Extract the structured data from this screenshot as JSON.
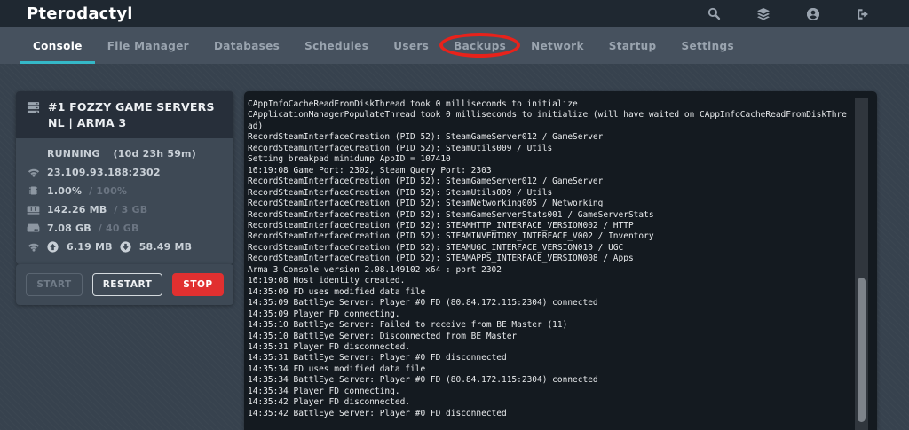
{
  "app": {
    "title": "Pterodactyl"
  },
  "topbar": {
    "icons": [
      "search-icon",
      "layers-icon",
      "user-circle-icon",
      "logout-icon"
    ]
  },
  "nav": {
    "tabs": [
      {
        "label": "Console",
        "active": true
      },
      {
        "label": "File Manager"
      },
      {
        "label": "Databases"
      },
      {
        "label": "Schedules"
      },
      {
        "label": "Users"
      },
      {
        "label": "Backups",
        "highlighted": true
      },
      {
        "label": "Network"
      },
      {
        "label": "Startup"
      },
      {
        "label": "Settings"
      }
    ],
    "highlight_annotation": "red ellipse drawn around Backups tab"
  },
  "server": {
    "name": "#1 FOZZY GAME SERVERS NL | ARMA 3",
    "status": "RUNNING",
    "uptime": "(10d 23h 59m)",
    "address": "23.109.93.188:2302",
    "cpu": {
      "used": "1.00%",
      "limit": "/ 100%"
    },
    "memory": {
      "used": "142.26 MB",
      "limit": "/ 3 GB"
    },
    "disk": {
      "used": "7.08 GB",
      "limit": "/ 40 GB"
    },
    "network": {
      "upload": "6.19 MB",
      "download": "58.49 MB"
    }
  },
  "power": {
    "start": "START",
    "restart": "RESTART",
    "stop": "STOP"
  },
  "console": {
    "lines": [
      "CAppInfoCacheReadFromDiskThread took 0 milliseconds to initialize",
      "CApplicationManagerPopulateThread took 0 milliseconds to initialize (will have waited on CAppInfoCacheReadFromDiskThread)",
      "RecordSteamInterfaceCreation (PID 52): SteamGameServer012 / GameServer",
      "RecordSteamInterfaceCreation (PID 52): SteamUtils009 / Utils",
      "Setting breakpad minidump AppID = 107410",
      "16:19:08 Game Port: 2302, Steam Query Port: 2303",
      "RecordSteamInterfaceCreation (PID 52): SteamGameServer012 / GameServer",
      "RecordSteamInterfaceCreation (PID 52): SteamUtils009 / Utils",
      "RecordSteamInterfaceCreation (PID 52): SteamNetworking005 / Networking",
      "RecordSteamInterfaceCreation (PID 52): SteamGameServerStats001 / GameServerStats",
      "RecordSteamInterfaceCreation (PID 52): STEAMHTTP_INTERFACE_VERSION002 / HTTP",
      "RecordSteamInterfaceCreation (PID 52): STEAMINVENTORY_INTERFACE_V002 / Inventory",
      "RecordSteamInterfaceCreation (PID 52): STEAMUGC_INTERFACE_VERSION010 / UGC",
      "RecordSteamInterfaceCreation (PID 52): STEAMAPPS_INTERFACE_VERSION008 / Apps",
      "Arma 3 Console version 2.08.149102 x64 : port 2302",
      "16:19:08 Host identity created.",
      "14:35:09 FD uses modified data file",
      "14:35:09 BattlEye Server: Player #0 FD (80.84.172.115:2304) connected",
      "14:35:09 Player FD connecting.",
      "14:35:10 BattlEye Server: Failed to receive from BE Master (11)",
      "14:35:10 BattlEye Server: Disconnected from BE Master",
      "14:35:31 Player FD disconnected.",
      "14:35:31 BattlEye Server: Player #0 FD disconnected",
      "14:35:34 FD uses modified data file",
      "14:35:34 BattlEye Server: Player #0 FD (80.84.172.115:2304) connected",
      "14:35:34 Player FD connecting.",
      "14:35:42 Player FD disconnected.",
      "14:35:42 BattlEye Server: Player #0 FD disconnected"
    ]
  },
  "colors": {
    "accent_cyan": "#35b8c8",
    "stop_red": "#e13030",
    "annotation_red": "#e8221b",
    "topbar_bg": "#1f2831",
    "navbar_bg": "#46515e",
    "page_bg": "#37424e",
    "panel_header_bg": "#272f3a",
    "panel_body_bg": "#3e4955",
    "console_bg": "#141a20"
  }
}
